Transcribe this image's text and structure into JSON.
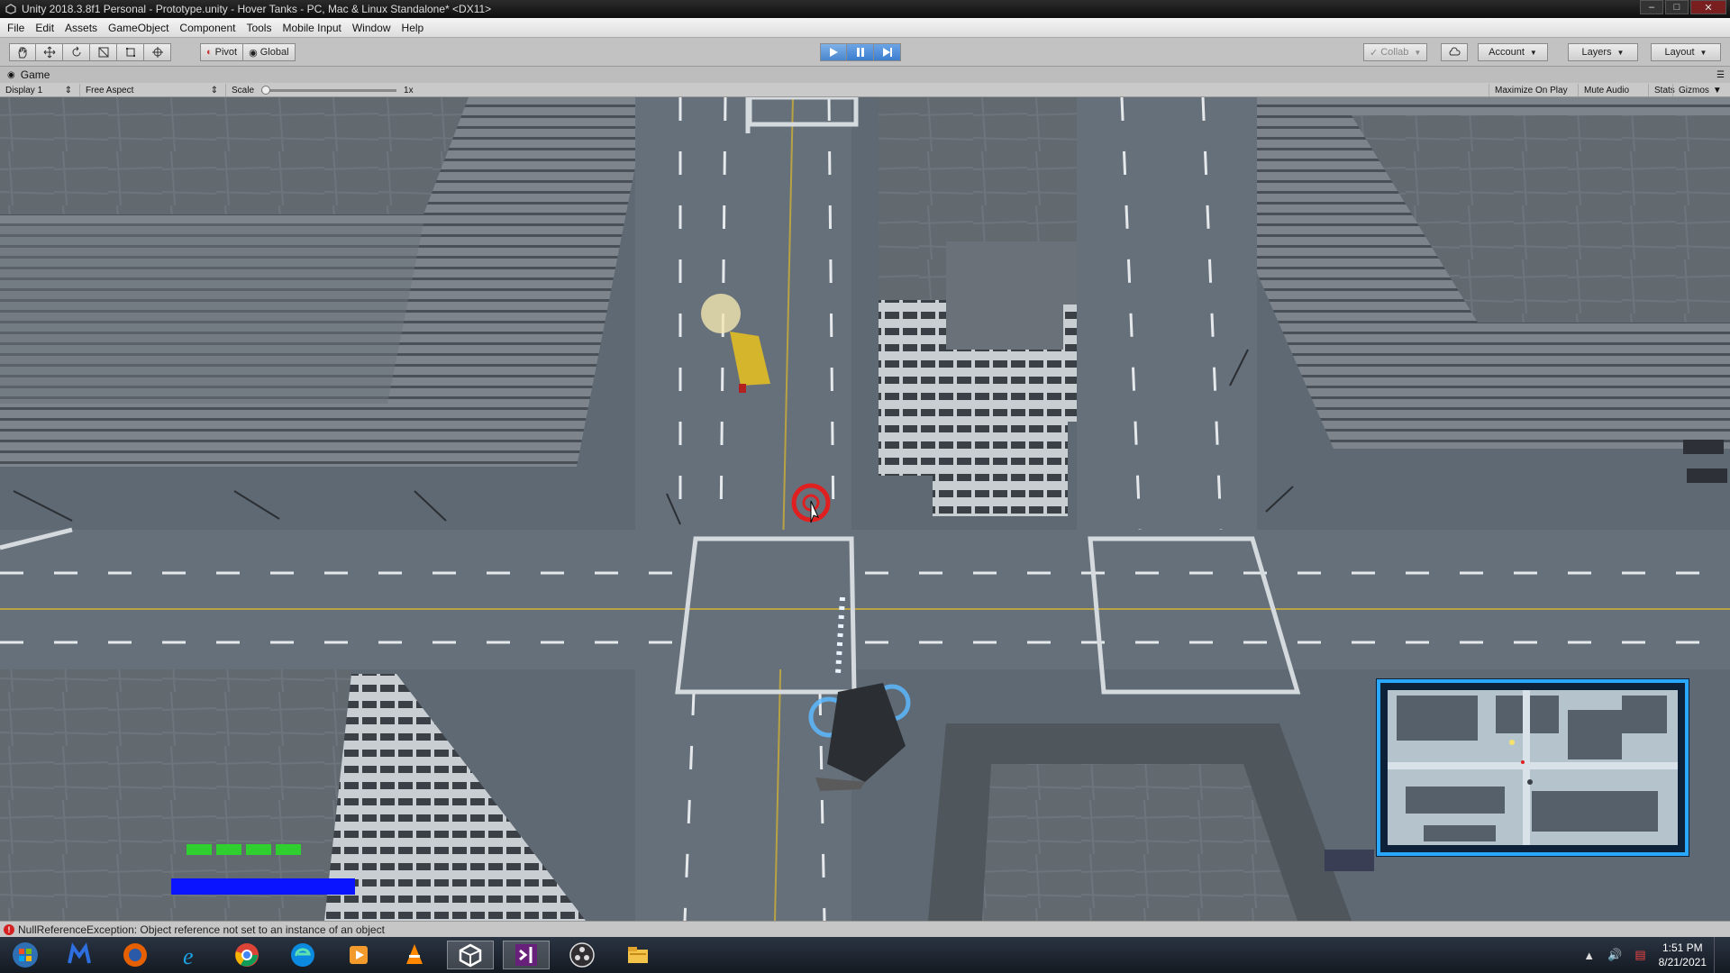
{
  "window": {
    "title": "Unity 2018.3.8f1 Personal - Prototype.unity - Hover Tanks - PC, Mac & Linux Standalone* <DX11>",
    "minimize": "–",
    "maximize": "□",
    "close": "✕"
  },
  "menu": [
    "File",
    "Edit",
    "Assets",
    "GameObject",
    "Component",
    "Tools",
    "Mobile Input",
    "Window",
    "Help"
  ],
  "toolbar": {
    "tools": [
      "hand-tool-icon",
      "move-tool-icon",
      "rotate-tool-icon",
      "scale-tool-icon",
      "rect-tool-icon",
      "transform-tool-icon"
    ],
    "pivot_label": "Pivot",
    "global_label": "Global",
    "collab_label": "Collab",
    "account_label": "Account",
    "layers_label": "Layers",
    "layout_label": "Layout"
  },
  "game_tab": {
    "title": "Game",
    "display": "Display 1",
    "aspect": "Free Aspect",
    "scale_label": "Scale",
    "scale_value": "1x",
    "maximize_on_play": "Maximize On Play",
    "mute_audio": "Mute Audio",
    "stats": "Stats",
    "gizmos": "Gizmos"
  },
  "hud": {
    "health_segments": 4,
    "energy": 1.0,
    "colors": {
      "health": "#2fcf2f",
      "energy": "#0a14ff",
      "target": "#e02020",
      "minimap_frame": "#2aa7ff"
    }
  },
  "status": {
    "message": "NullReferenceException: Object reference not set to an instance of an object"
  },
  "taskbar": {
    "apps": [
      "windows-start-icon",
      "malwarebytes-icon",
      "firefox-icon",
      "internet-explorer-icon",
      "chrome-icon",
      "edge-icon",
      "media-player-icon",
      "vlc-icon",
      "unity-icon",
      "visual-studio-icon",
      "obs-icon",
      "file-explorer-icon"
    ],
    "time": "1:51 PM",
    "date": "8/21/2021"
  }
}
